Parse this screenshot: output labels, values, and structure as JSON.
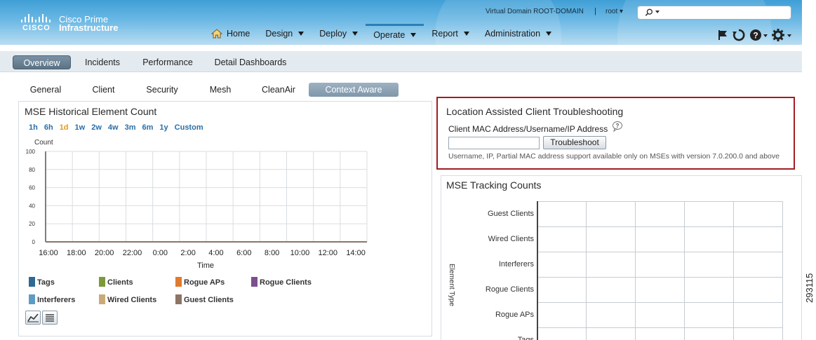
{
  "header": {
    "brand_line1": "Cisco Prime",
    "brand_line2": "Infrastructure",
    "brand_logo_text": "CISCO",
    "virtual_domain": "Virtual Domain ROOT-DOMAIN",
    "separator": "|",
    "user": "root ▾",
    "search_placeholder": "",
    "nav": [
      {
        "label": "Home",
        "icon": "home-icon",
        "has_menu": false,
        "active": false
      },
      {
        "label": "Design",
        "has_menu": true,
        "active": false
      },
      {
        "label": "Deploy",
        "has_menu": true,
        "active": false
      },
      {
        "label": "Operate",
        "has_menu": true,
        "active": true
      },
      {
        "label": "Report",
        "has_menu": true,
        "active": false
      },
      {
        "label": "Administration",
        "has_menu": true,
        "active": false
      }
    ],
    "tool_icons": [
      "flag-icon",
      "refresh-icon",
      "help-icon",
      "gear-icon"
    ],
    "accent_color": "#3f9fd6"
  },
  "primary_tabs": [
    {
      "label": "Overview",
      "active": true
    },
    {
      "label": "Incidents",
      "active": false
    },
    {
      "label": "Performance",
      "active": false
    },
    {
      "label": "Detail Dashboards",
      "active": false
    }
  ],
  "secondary_tabs": [
    {
      "label": "General",
      "active": false
    },
    {
      "label": "Client",
      "active": false
    },
    {
      "label": "Security",
      "active": false
    },
    {
      "label": "Mesh",
      "active": false
    },
    {
      "label": "CleanAir",
      "active": false
    },
    {
      "label": "Context Aware",
      "active": true
    }
  ],
  "historical": {
    "title": "MSE Historical Element Count",
    "time_links": [
      {
        "label": "1h",
        "selected": false
      },
      {
        "label": "6h",
        "selected": false
      },
      {
        "label": "1d",
        "selected": true
      },
      {
        "label": "1w",
        "selected": false
      },
      {
        "label": "2w",
        "selected": false
      },
      {
        "label": "4w",
        "selected": false
      },
      {
        "label": "3m",
        "selected": false
      },
      {
        "label": "6m",
        "selected": false
      },
      {
        "label": "1y",
        "selected": false
      },
      {
        "label": "Custom",
        "selected": false
      }
    ],
    "legend": [
      {
        "label": "Tags",
        "color": "#2f6a92"
      },
      {
        "label": "Clients",
        "color": "#7d9a3a"
      },
      {
        "label": "Rogue APs",
        "color": "#e07b2e"
      },
      {
        "label": "Rogue Clients",
        "color": "#7c4f8e"
      },
      {
        "label": "Interferers",
        "color": "#5e9cc6"
      },
      {
        "label": "Wired Clients",
        "color": "#c9aa77"
      },
      {
        "label": "Guest Clients",
        "color": "#8e7465"
      }
    ],
    "view_icons": [
      "line-chart-icon",
      "table-view-icon"
    ]
  },
  "location": {
    "title": "Location Assisted Client Troubleshooting",
    "field_label": "Client MAC Address/Username/IP Address",
    "input_value": "",
    "button_label": "Troubleshoot",
    "note": "Username, IP, Partial MAC address support available only on MSEs with version 7.0.200.0 and above",
    "highlight_color": "#a31c25"
  },
  "tracking": {
    "title": "MSE Tracking Counts",
    "axis_label": "Element Type",
    "categories": [
      "Guest Clients",
      "Wired Clients",
      "Interferers",
      "Rogue Clients",
      "Rogue APs",
      "Tags"
    ]
  },
  "side_label": "293115",
  "chart_data": [
    {
      "type": "line",
      "title": "MSE Historical Element Count",
      "xlabel": "Time",
      "ylabel": "Count",
      "x": [
        "16:00",
        "18:00",
        "20:00",
        "22:00",
        "0:00",
        "2:00",
        "4:00",
        "6:00",
        "8:00",
        "10:00",
        "12:00",
        "14:00"
      ],
      "yticks": [
        0,
        20,
        40,
        60,
        80,
        100
      ],
      "ylim": [
        0,
        100
      ],
      "grid": true,
      "series": [
        {
          "name": "Tags",
          "values": [
            0,
            0,
            0,
            0,
            0,
            0,
            0,
            0,
            0,
            0,
            0,
            0
          ]
        },
        {
          "name": "Clients",
          "values": [
            0,
            0,
            0,
            0,
            0,
            0,
            0,
            0,
            0,
            0,
            0,
            0
          ]
        },
        {
          "name": "Rogue APs",
          "values": [
            0,
            0,
            0,
            0,
            0,
            0,
            0,
            0,
            0,
            0,
            0,
            0
          ]
        },
        {
          "name": "Rogue Clients",
          "values": [
            0,
            0,
            0,
            0,
            0,
            0,
            0,
            0,
            0,
            0,
            0,
            0
          ]
        },
        {
          "name": "Interferers",
          "values": [
            0,
            0,
            0,
            0,
            0,
            0,
            0,
            0,
            0,
            0,
            0,
            0
          ]
        },
        {
          "name": "Wired Clients",
          "values": [
            0,
            0,
            0,
            0,
            0,
            0,
            0,
            0,
            0,
            0,
            0,
            0
          ]
        },
        {
          "name": "Guest Clients",
          "values": [
            0,
            0,
            0,
            0,
            0,
            0,
            0,
            0,
            0,
            0,
            0,
            0
          ]
        }
      ]
    },
    {
      "type": "bar",
      "title": "MSE Tracking Counts",
      "ylabel": "Element Type",
      "categories": [
        "Guest Clients",
        "Wired Clients",
        "Interferers",
        "Rogue Clients",
        "Rogue APs",
        "Tags"
      ],
      "grid": true
    }
  ]
}
